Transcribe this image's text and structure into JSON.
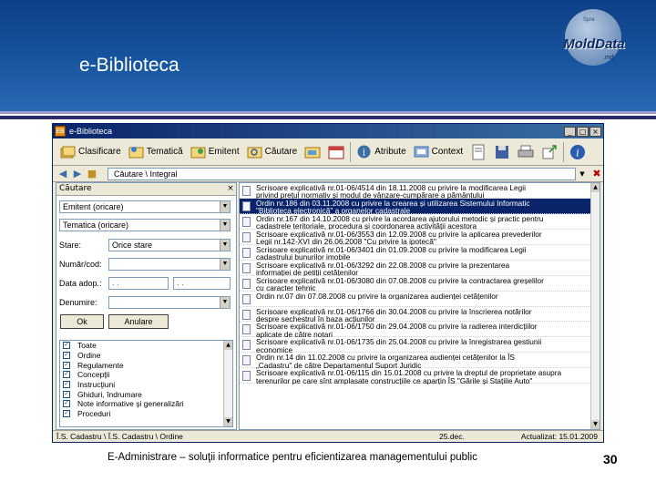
{
  "slide": {
    "title": "e-Biblioteca",
    "footer": "E-Administrare – soluţii informatice pentru eficientizarea managementului public",
    "page_number": "30"
  },
  "logo": {
    "text": "MoldData",
    "subtext": ".md",
    "arc_text": "Spre"
  },
  "window": {
    "title": "e-Biblioteca",
    "app_icon": "EB",
    "min": "_",
    "max": "□",
    "close": "×"
  },
  "toolbar": {
    "clasificare": "Clasificare",
    "tematica": "Tematică",
    "emitent": "Emitent",
    "cautare": "Căutare",
    "atribute": "Atribute",
    "context": "Context"
  },
  "addressbar": {
    "path": "Căutare \\ Integral"
  },
  "search": {
    "header": "Căutare",
    "emitent": "Emitent (oricare)",
    "tematica": "Tematica (oricare)",
    "stare_label": "Stare:",
    "stare_value": "Orice stare",
    "numar_label": "Număr/cod:",
    "data_label": "Data adop.:",
    "data_from": ". .",
    "data_to": ". .",
    "denumire_label": "Denumire:",
    "ok": "Ok",
    "anulare": "Anulare",
    "categories": [
      "Toate",
      "Ordine",
      "Regulamente",
      "Concepţii",
      "Instrucţiuni",
      "Ghiduri, îndrumare",
      "Note informative şi generalizări",
      "Proceduri"
    ]
  },
  "documents": [
    {
      "line1": "Scrisoare explicativă nr.01-06/4514 din 18.11.2008 cu privire la modificarea Legii",
      "line2": "privind prețul normativ și modul de vânzare-cumpărare a pământului"
    },
    {
      "line1": "Ordin nr.186 din 03.11.2008 cu privire la crearea și utilizarea Sistemului Informatic",
      "line2": "\"Biblioteca electronică\" a organelor cadastrale"
    },
    {
      "line1": "Ordin nr.167 din 14.10.2008 cu privire la acordarea ajutorului metodic și practic pentru",
      "line2": "cadastrele teritoriale, procedura și coordonarea activității acestora"
    },
    {
      "line1": "Scrisoare explicativă nr.01-06/3553 din 12.09.2008 cu privire la aplicarea prevederilor",
      "line2": "Legii nr.142-XVI din 26.06.2008 \"Cu privire la ipotecă\""
    },
    {
      "line1": "Scrisoare explicativă nr.01-06/3401 din 01.09.2008 cu privire la modificarea Legii",
      "line2": "cadastrului bunurilor imobile"
    },
    {
      "line1": "Scrisoare explicativă nr.01-06/3292 din 22.08.2008 cu privire la prezentarea",
      "line2": "informației de petiții cetățenilor"
    },
    {
      "line1": "Scrisoare explicativă nr.01-06/3080 din 07.08.2008 cu privire la contractarea greșelilor",
      "line2": "cu caracter tehnic"
    },
    {
      "line1": "Ordin nr.07 din 07.08.2008 cu privire la organizarea audienței cetățenilor",
      "line2": ""
    },
    {
      "line1": "Scrisoare explicativă nr.01-06/1766 din 30.04.2008 cu privire la înscrierea notărilor",
      "line2": "despre sechestrul în baza acțiunilor"
    },
    {
      "line1": "Scrisoare explicativă nr.01-06/1750 din 29.04.2008 cu privire la radierea interdicțiilor",
      "line2": "aplicate de către notari"
    },
    {
      "line1": "Scrisoare explicativă nr.01-06/1735 din 25.04.2008 cu privire la înregistrarea gestiunii",
      "line2": "economice"
    },
    {
      "line1": "Ordin nr.14 din 11.02.2008 cu privire la organizarea audienței cetățenilor la ÎS",
      "line2": "„Cadastru\" de către Departamentul Suport Juridic"
    },
    {
      "line1": "Scrisoare explicativă nr.01-06/115 din 15.01.2008 cu privire la dreptul de proprietate asupra",
      "line2": "terenurilor pe care sînt amplasate construcțiile ce aparțin ÎS \"Gările și Stațiile Auto\""
    }
  ],
  "selected_index": 1,
  "statusbar": {
    "path": "Î.S. Cadastru \\ Î.S. Cadastru \\ Ordine",
    "date": "25.dec.",
    "update": "Actualizat: 15.01.2009"
  },
  "icons": {
    "clasificare": "folders-icon",
    "tematica": "folder-star-icon",
    "emitent": "emitter-icon",
    "cautare": "search-folder-icon",
    "atribute": "info-icon",
    "context": "context-icon"
  }
}
